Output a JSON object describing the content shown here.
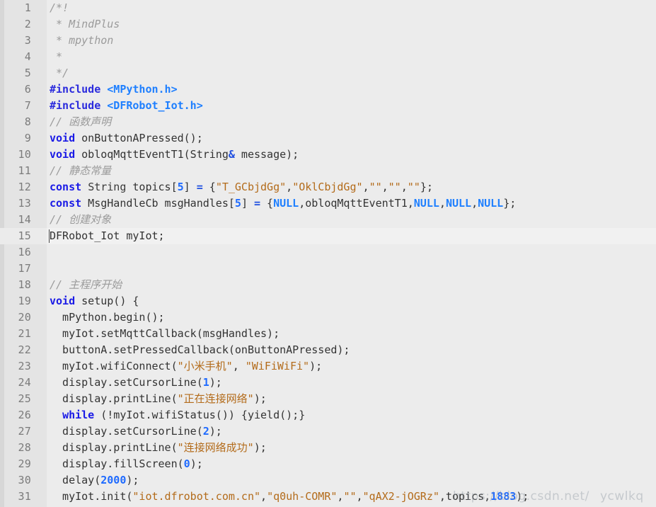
{
  "editor": {
    "language": "cpp",
    "active_line": 15,
    "first_visible_line": 1,
    "last_visible_line": 31,
    "colors": {
      "background": "#ececec",
      "gutter": "#e4e4e4",
      "active_line": "#f1f1f1",
      "line_number": "#7b7b7b",
      "text": "#333333",
      "comment": "#9b9b9b",
      "keyword": "#1a1ae6",
      "string": "#b36b1a",
      "number": "#1f6bff",
      "constant": "#1e7fff",
      "header": "#1e7fff"
    }
  },
  "watermark": {
    "part1": "https://blog.csdn.net/",
    "part2": "ycwlkq"
  },
  "lines": [
    {
      "num": "1",
      "fold": "▾",
      "tokens": [
        {
          "t": "/*!",
          "c": "comment"
        }
      ]
    },
    {
      "num": "2",
      "fold": "",
      "tokens": [
        {
          "t": " * MindPlus",
          "c": "comment"
        }
      ]
    },
    {
      "num": "3",
      "fold": "",
      "tokens": [
        {
          "t": " * mpython",
          "c": "comment"
        }
      ]
    },
    {
      "num": "4",
      "fold": "",
      "tokens": [
        {
          "t": " *",
          "c": "comment"
        }
      ]
    },
    {
      "num": "5",
      "fold": "",
      "tokens": [
        {
          "t": " */",
          "c": "comment"
        }
      ]
    },
    {
      "num": "6",
      "fold": "",
      "tokens": [
        {
          "t": "#include",
          "c": "preproc"
        },
        {
          "t": " ",
          "c": "plain"
        },
        {
          "t": "<MPython.h>",
          "c": "header"
        }
      ]
    },
    {
      "num": "7",
      "fold": "",
      "tokens": [
        {
          "t": "#include",
          "c": "preproc"
        },
        {
          "t": " ",
          "c": "plain"
        },
        {
          "t": "<DFRobot_Iot.h>",
          "c": "header"
        }
      ]
    },
    {
      "num": "8",
      "fold": "",
      "tokens": [
        {
          "t": "// 函数声明",
          "c": "comment"
        }
      ]
    },
    {
      "num": "9",
      "fold": "",
      "tokens": [
        {
          "t": "void",
          "c": "keyword"
        },
        {
          "t": " onButtonAPressed();",
          "c": "plain"
        }
      ]
    },
    {
      "num": "10",
      "fold": "",
      "tokens": [
        {
          "t": "void",
          "c": "keyword"
        },
        {
          "t": " obloqMqttEventT1(String",
          "c": "plain"
        },
        {
          "t": "&",
          "c": "op"
        },
        {
          "t": " message);",
          "c": "plain"
        }
      ]
    },
    {
      "num": "11",
      "fold": "",
      "tokens": [
        {
          "t": "// 静态常量",
          "c": "comment"
        }
      ]
    },
    {
      "num": "12",
      "fold": "",
      "tokens": [
        {
          "t": "const",
          "c": "keyword"
        },
        {
          "t": " ",
          "c": "plain"
        },
        {
          "t": "String",
          "c": "type"
        },
        {
          "t": " topics[",
          "c": "plain"
        },
        {
          "t": "5",
          "c": "number"
        },
        {
          "t": "] ",
          "c": "plain"
        },
        {
          "t": "=",
          "c": "op"
        },
        {
          "t": " {",
          "c": "plain"
        },
        {
          "t": "\"T_GCbjdGg\"",
          "c": "string"
        },
        {
          "t": ",",
          "c": "plain"
        },
        {
          "t": "\"OklCbjdGg\"",
          "c": "string"
        },
        {
          "t": ",",
          "c": "plain"
        },
        {
          "t": "\"\"",
          "c": "string"
        },
        {
          "t": ",",
          "c": "plain"
        },
        {
          "t": "\"\"",
          "c": "string"
        },
        {
          "t": ",",
          "c": "plain"
        },
        {
          "t": "\"\"",
          "c": "string"
        },
        {
          "t": "};",
          "c": "plain"
        }
      ]
    },
    {
      "num": "13",
      "fold": "",
      "tokens": [
        {
          "t": "const",
          "c": "keyword"
        },
        {
          "t": " MsgHandleCb msgHandles[",
          "c": "plain"
        },
        {
          "t": "5",
          "c": "number"
        },
        {
          "t": "] ",
          "c": "plain"
        },
        {
          "t": "=",
          "c": "op"
        },
        {
          "t": " {",
          "c": "plain"
        },
        {
          "t": "NULL",
          "c": "const"
        },
        {
          "t": ",obloqMqttEventT1,",
          "c": "plain"
        },
        {
          "t": "NULL",
          "c": "const"
        },
        {
          "t": ",",
          "c": "plain"
        },
        {
          "t": "NULL",
          "c": "const"
        },
        {
          "t": ",",
          "c": "plain"
        },
        {
          "t": "NULL",
          "c": "const"
        },
        {
          "t": "};",
          "c": "plain"
        }
      ]
    },
    {
      "num": "14",
      "fold": "",
      "tokens": [
        {
          "t": "// 创建对象",
          "c": "comment"
        }
      ]
    },
    {
      "num": "15",
      "fold": "",
      "active": true,
      "tokens": [
        {
          "t": "DFRobot_Iot myIot;",
          "c": "plain"
        }
      ]
    },
    {
      "num": "16",
      "fold": "",
      "tokens": []
    },
    {
      "num": "17",
      "fold": "",
      "tokens": []
    },
    {
      "num": "18",
      "fold": "",
      "tokens": [
        {
          "t": "// 主程序开始",
          "c": "comment"
        }
      ]
    },
    {
      "num": "19",
      "fold": "▾",
      "tokens": [
        {
          "t": "void",
          "c": "keyword"
        },
        {
          "t": " setup() {",
          "c": "plain"
        }
      ]
    },
    {
      "num": "20",
      "fold": "",
      "tokens": [
        {
          "t": "  mPython.begin();",
          "c": "plain"
        }
      ]
    },
    {
      "num": "21",
      "fold": "",
      "tokens": [
        {
          "t": "  myIot.setMqttCallback(msgHandles);",
          "c": "plain"
        }
      ]
    },
    {
      "num": "22",
      "fold": "",
      "tokens": [
        {
          "t": "  buttonA.setPressedCallback(onButtonAPressed);",
          "c": "plain"
        }
      ]
    },
    {
      "num": "23",
      "fold": "",
      "tokens": [
        {
          "t": "  myIot.wifiConnect(",
          "c": "plain"
        },
        {
          "t": "\"小米手机\"",
          "c": "string"
        },
        {
          "t": ", ",
          "c": "plain"
        },
        {
          "t": "\"WiFiWiFi\"",
          "c": "string"
        },
        {
          "t": ");",
          "c": "plain"
        }
      ]
    },
    {
      "num": "24",
      "fold": "",
      "tokens": [
        {
          "t": "  display.setCursorLine(",
          "c": "plain"
        },
        {
          "t": "1",
          "c": "number"
        },
        {
          "t": ");",
          "c": "plain"
        }
      ]
    },
    {
      "num": "25",
      "fold": "",
      "tokens": [
        {
          "t": "  display.printLine(",
          "c": "plain"
        },
        {
          "t": "\"正在连接网络\"",
          "c": "string"
        },
        {
          "t": ");",
          "c": "plain"
        }
      ]
    },
    {
      "num": "26",
      "fold": "",
      "tokens": [
        {
          "t": "  ",
          "c": "plain"
        },
        {
          "t": "while",
          "c": "keyword"
        },
        {
          "t": " (!myIot.wifiStatus()) {yield();}",
          "c": "plain"
        }
      ]
    },
    {
      "num": "27",
      "fold": "",
      "tokens": [
        {
          "t": "  display.setCursorLine(",
          "c": "plain"
        },
        {
          "t": "2",
          "c": "number"
        },
        {
          "t": ");",
          "c": "plain"
        }
      ]
    },
    {
      "num": "28",
      "fold": "",
      "tokens": [
        {
          "t": "  display.printLine(",
          "c": "plain"
        },
        {
          "t": "\"连接网络成功\"",
          "c": "string"
        },
        {
          "t": ");",
          "c": "plain"
        }
      ]
    },
    {
      "num": "29",
      "fold": "",
      "tokens": [
        {
          "t": "  display.fillScreen(",
          "c": "plain"
        },
        {
          "t": "0",
          "c": "number"
        },
        {
          "t": ");",
          "c": "plain"
        }
      ]
    },
    {
      "num": "30",
      "fold": "",
      "tokens": [
        {
          "t": "  delay(",
          "c": "plain"
        },
        {
          "t": "2000",
          "c": "number"
        },
        {
          "t": ");",
          "c": "plain"
        }
      ]
    },
    {
      "num": "31",
      "fold": "",
      "tokens": [
        {
          "t": "  myIot.init(",
          "c": "plain"
        },
        {
          "t": "\"iot.dfrobot.com.cn\"",
          "c": "string"
        },
        {
          "t": ",",
          "c": "plain"
        },
        {
          "t": "\"q0uh-COMR\"",
          "c": "string"
        },
        {
          "t": ",",
          "c": "plain"
        },
        {
          "t": "\"\"",
          "c": "string"
        },
        {
          "t": ",",
          "c": "plain"
        },
        {
          "t": "\"qAX2-jOGRz\"",
          "c": "string"
        },
        {
          "t": ",topics,",
          "c": "plain"
        },
        {
          "t": "1883",
          "c": "number"
        },
        {
          "t": ");",
          "c": "plain"
        }
      ]
    }
  ]
}
